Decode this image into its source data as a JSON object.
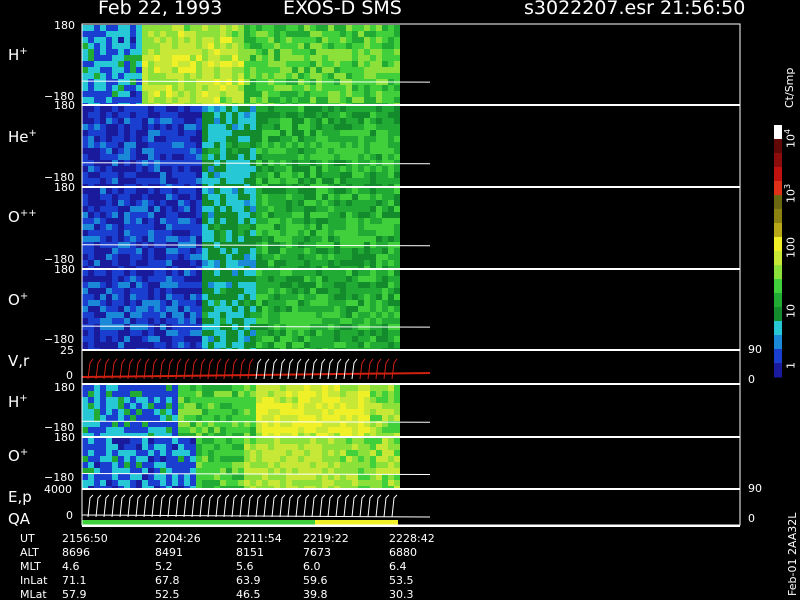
{
  "header": {
    "date": "Feb 22, 1993",
    "instrument": "EXOS-D SMS",
    "file": "s3022207.esr",
    "time": "21:56:50"
  },
  "colorbar": {
    "unit": "Ct/Smp",
    "tick_labels": [
      "1",
      "10",
      "100",
      "10",
      "10"
    ],
    "tick_exponents": [
      "",
      "",
      "",
      "3",
      "4"
    ],
    "colors": [
      "#1a1a9c",
      "#1a3fd0",
      "#1a8ad8",
      "#26c8d6",
      "#138a2c",
      "#21aa34",
      "#3fd03c",
      "#8be03a",
      "#c8e838",
      "#f0f028",
      "#b8a818",
      "#8c8212",
      "#6a6810",
      "#e03018",
      "#c01010",
      "#8c0c0c",
      "#600808",
      "#ffffff"
    ]
  },
  "footer": {
    "version": "Feb-01 2AA32L"
  },
  "chart_data": {
    "type": "heatmap",
    "panels": [
      {
        "name": "H",
        "charge": "+",
        "ymax": "180",
        "ymin": "−180",
        "kind": "spectrogram",
        "palette": "mix"
      },
      {
        "name": "He",
        "charge": "+",
        "ymax": "180",
        "ymin": "−180",
        "kind": "spectrogram",
        "palette": "cool"
      },
      {
        "name": "O",
        "charge": "++",
        "ymax": "180",
        "ymin": "−180",
        "kind": "spectrogram",
        "palette": "cool"
      },
      {
        "name": "O",
        "charge": "+",
        "ymax": "180",
        "ymin": "−180",
        "kind": "spectrogram",
        "palette": "cool"
      },
      {
        "name": "V,r",
        "charge": "",
        "ymax": "25",
        "ymin": "0",
        "right_max": "90",
        "right_min": "0",
        "kind": "line"
      },
      {
        "name": "H",
        "charge": "+",
        "ymax": "180",
        "ymin": "−180",
        "kind": "spectrogram",
        "palette": "warm"
      },
      {
        "name": "O",
        "charge": "+",
        "ymax": "180",
        "ymin": "−180",
        "kind": "spectrogram",
        "palette": "green"
      },
      {
        "name": "E,p",
        "charge": "",
        "ymax": "4000",
        "ymin": "0",
        "right_max": "90",
        "right_min": "0",
        "kind": "line",
        "sublabel": "QA"
      }
    ],
    "time_axis": {
      "rows": [
        {
          "label": "UT",
          "values": [
            "2156:50",
            "2204:26",
            "2211:54",
            "2219:22",
            "2228:42"
          ]
        },
        {
          "label": "ALT",
          "values": [
            "8696",
            "8491",
            "8151",
            "7673",
            "6880"
          ]
        },
        {
          "label": "MLT",
          "values": [
            "4.6",
            "5.2",
            "5.6",
            "6.0",
            "6.4"
          ]
        },
        {
          "label": "InLat",
          "values": [
            "71.1",
            "67.8",
            "63.9",
            "59.6",
            "53.5"
          ]
        },
        {
          "label": "MLat",
          "values": [
            "57.9",
            "52.5",
            "46.5",
            "39.8",
            "30.3"
          ]
        }
      ]
    }
  }
}
